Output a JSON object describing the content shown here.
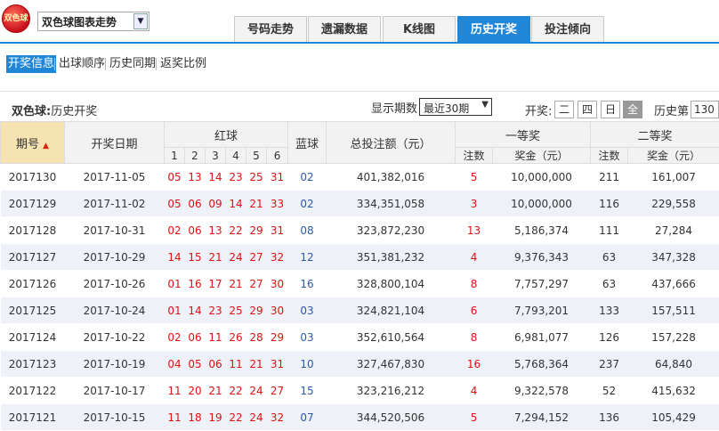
{
  "header": {
    "logo_text": "双色球",
    "selector_label": "双色球图表走势",
    "tabs": [
      "号码走势",
      "遗漏数据",
      "K线图",
      "历史开奖",
      "投注倾向"
    ],
    "active_tab": 3
  },
  "subnav": {
    "items": [
      "开奖信息",
      "出球顺序",
      "历史同期",
      "返奖比例"
    ],
    "active": 0
  },
  "controls": {
    "title_bold": "双色球:",
    "title_rest": "历史开奖",
    "period_label": "显示期数",
    "period_value": "最近30期",
    "kj_label": "开奖:",
    "days": [
      "二",
      "四",
      "日",
      "全"
    ],
    "active_day": 3,
    "history_label": "历史第",
    "history_value": "130"
  },
  "table": {
    "headers": {
      "issue": "期号",
      "date": "开奖日期",
      "red": "红球",
      "red_positions": [
        "1",
        "2",
        "3",
        "4",
        "5",
        "6"
      ],
      "blue": "蓝球",
      "total": "总投注额（元）",
      "first": "一等奖",
      "second": "二等奖",
      "count": "注数",
      "prize": "奖金（元）"
    },
    "rows": [
      {
        "issue": "2017130",
        "date": "2017-11-05",
        "red": [
          "05",
          "13",
          "14",
          "23",
          "25",
          "31"
        ],
        "blue": "02",
        "total": "401,382,016",
        "first_count": "5",
        "first_prize": "10,000,000",
        "second_count": "211",
        "second_prize": "161,007"
      },
      {
        "issue": "2017129",
        "date": "2017-11-02",
        "red": [
          "05",
          "06",
          "09",
          "14",
          "21",
          "33"
        ],
        "blue": "02",
        "total": "334,351,058",
        "first_count": "3",
        "first_prize": "10,000,000",
        "second_count": "116",
        "second_prize": "229,558"
      },
      {
        "issue": "2017128",
        "date": "2017-10-31",
        "red": [
          "02",
          "06",
          "13",
          "22",
          "29",
          "31"
        ],
        "blue": "08",
        "total": "323,872,230",
        "first_count": "13",
        "first_prize": "5,186,374",
        "second_count": "111",
        "second_prize": "27,284"
      },
      {
        "issue": "2017127",
        "date": "2017-10-29",
        "red": [
          "14",
          "15",
          "21",
          "24",
          "27",
          "32"
        ],
        "blue": "12",
        "total": "351,381,232",
        "first_count": "4",
        "first_prize": "9,376,343",
        "second_count": "63",
        "second_prize": "347,328"
      },
      {
        "issue": "2017126",
        "date": "2017-10-26",
        "red": [
          "01",
          "16",
          "17",
          "21",
          "27",
          "30"
        ],
        "blue": "16",
        "total": "328,800,104",
        "first_count": "8",
        "first_prize": "7,757,297",
        "second_count": "63",
        "second_prize": "437,666"
      },
      {
        "issue": "2017125",
        "date": "2017-10-24",
        "red": [
          "01",
          "14",
          "23",
          "25",
          "29",
          "30"
        ],
        "blue": "03",
        "total": "324,821,104",
        "first_count": "6",
        "first_prize": "7,793,201",
        "second_count": "133",
        "second_prize": "157,511"
      },
      {
        "issue": "2017124",
        "date": "2017-10-22",
        "red": [
          "02",
          "06",
          "11",
          "26",
          "28",
          "29"
        ],
        "blue": "03",
        "total": "352,610,564",
        "first_count": "8",
        "first_prize": "6,981,077",
        "second_count": "126",
        "second_prize": "157,228"
      },
      {
        "issue": "2017123",
        "date": "2017-10-19",
        "red": [
          "04",
          "05",
          "06",
          "11",
          "21",
          "31"
        ],
        "blue": "10",
        "total": "327,467,830",
        "first_count": "16",
        "first_prize": "5,768,364",
        "second_count": "237",
        "second_prize": "64,840"
      },
      {
        "issue": "2017122",
        "date": "2017-10-17",
        "red": [
          "11",
          "20",
          "21",
          "22",
          "24",
          "27"
        ],
        "blue": "15",
        "total": "323,216,212",
        "first_count": "4",
        "first_prize": "9,322,578",
        "second_count": "52",
        "second_prize": "415,632"
      },
      {
        "issue": "2017121",
        "date": "2017-10-15",
        "red": [
          "11",
          "18",
          "19",
          "22",
          "24",
          "32"
        ],
        "blue": "07",
        "total": "344,520,506",
        "first_count": "5",
        "first_prize": "7,294,152",
        "second_count": "136",
        "second_prize": "105,429"
      }
    ]
  },
  "colors": {
    "accent": "#1f86d8",
    "red_ball": "#dd1111",
    "blue_ball": "#2a5aa8",
    "sort_header": "#f5e3b2",
    "row_alt": "#eef2f8"
  }
}
